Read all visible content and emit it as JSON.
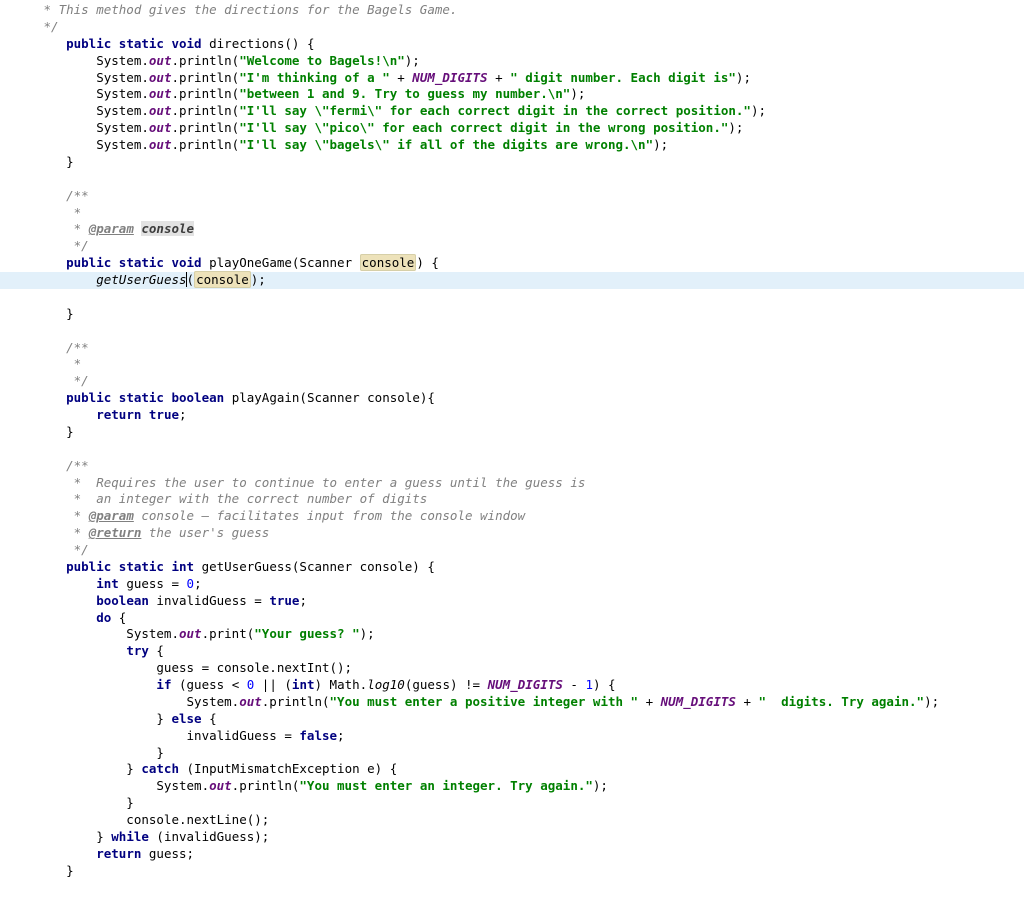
{
  "method_directions": {
    "doc_line1": " * This method gives the directions for the Bagels Game.",
    "doc_close": " */",
    "sig_kw1": "public",
    "sig_kw2": "static",
    "sig_kw3": "void",
    "sig_name": "directions",
    "l1_pre": "        System.",
    "l1_out": "out",
    "l1_mid": ".println(",
    "l1_str": "\"Welcome to Bagels!\\n\"",
    "l1_end": ");",
    "l2_pre": "        System.",
    "l2_out": "out",
    "l2_mid": ".println(",
    "l2_str1": "\"I'm thinking of a \"",
    "l2_plus1": " + ",
    "l2_const": "NUM_DIGITS",
    "l2_plus2": " + ",
    "l2_str2": "\" digit number. Each digit is\"",
    "l2_end": ");",
    "l3_pre": "        System.",
    "l3_out": "out",
    "l3_mid": ".println(",
    "l3_str": "\"between 1 and 9. Try to guess my number.\\n\"",
    "l3_end": ");",
    "l4_pre": "        System.",
    "l4_out": "out",
    "l4_mid": ".println(",
    "l4_str": "\"I'll say \\\"fermi\\\" for each correct digit in the correct position.\"",
    "l4_end": ");",
    "l5_pre": "        System.",
    "l5_out": "out",
    "l5_mid": ".println(",
    "l5_str": "\"I'll say \\\"pico\\\" for each correct digit in the wrong position.\"",
    "l5_end": ");",
    "l6_pre": "        System.",
    "l6_out": "out",
    "l6_mid": ".println(",
    "l6_str": "\"I'll say \\\"bagels\\\" if all of the digits are wrong.\\n\"",
    "l6_end": ");",
    "close": "    }"
  },
  "method_playone": {
    "doc_open": "    /**",
    "doc_star": "     *",
    "doc_param_tag": "@param",
    "doc_param_name": "console",
    "doc_close": "     */",
    "sig_kw1": "public",
    "sig_kw2": "static",
    "sig_kw3": "void",
    "sig_name": "playOneGame",
    "sig_ptype": "Scanner",
    "sig_pname": "console",
    "body_call": "getUserGuess",
    "body_arg": "console",
    "close": "    }"
  },
  "method_playagain": {
    "doc_open": "    /**",
    "doc_star": "     *",
    "doc_close": "     */",
    "sig_kw1": "public",
    "sig_kw2": "static",
    "sig_kw3": "boolean",
    "sig_name": "playAgain",
    "sig_ptype": "Scanner",
    "sig_pname": "console",
    "ret_kw": "return",
    "ret_val": "true",
    "close": "    }"
  },
  "method_getguess": {
    "doc_open": "    /**",
    "doc_l1": "     *  Requires the user to continue to enter a guess until the guess is",
    "doc_l2": "     *  an integer with the correct number of digits",
    "doc_param_tag": "@param",
    "doc_param_rest": " console – facilitates input from the console window",
    "doc_ret_tag": "@return",
    "doc_ret_rest": " the user's guess",
    "doc_close": "     */",
    "sig_kw1": "public",
    "sig_kw2": "static",
    "sig_kw3": "int",
    "sig_name": "getUserGuess",
    "sig_ptype": "Scanner",
    "sig_pname": "console",
    "b1_kw": "int",
    "b1_var": " guess = ",
    "b1_num": "0",
    "b1_end": ";",
    "b2_kw": "boolean",
    "b2_var": " invalidGuess = ",
    "b2_val": "true",
    "b2_end": ";",
    "do_kw": "do",
    "p_pre": "            System.",
    "p_out": "out",
    "p_mid": ".print(",
    "p_str": "\"Your guess? \"",
    "p_end": ");",
    "try_kw": "try",
    "ni": "                guess = console.nextInt();",
    "if_kw": "if",
    "if_cond_pre": " (guess < ",
    "if_num0": "0",
    "if_mid": " || (",
    "if_cast": "int",
    "if_mid2": ") Math.",
    "if_log": "log10",
    "if_mid3": "(guess) != ",
    "if_const": "NUM_DIGITS",
    "if_mid4": " - ",
    "if_num1": "1",
    "if_end": ") {",
    "err_pre": "                    System.",
    "err_out": "out",
    "err_mid": ".println(",
    "err_str1": "\"You must enter a positive integer with \"",
    "err_plus1": " + ",
    "err_const": "NUM_DIGITS",
    "err_plus2": " + ",
    "err_str2": "\"  digits. Try again.\"",
    "err_end": ");",
    "else_kw": "else",
    "inv": "                    invalidGuess = ",
    "inv_val": "false",
    "inv_end": ";",
    "cb1": "                }",
    "catch_kw": "catch",
    "catch_type": "InputMismatchException",
    "catch_var": "e",
    "err2_pre": "                System.",
    "err2_out": "out",
    "err2_mid": ".println(",
    "err2_str": "\"You must enter an integer. Try again.\"",
    "err2_end": ");",
    "cb2": "            }",
    "nl": "            console.nextLine();",
    "while_kw": "while",
    "while_rest": " (invalidGuess);",
    "ret_kw": "return",
    "ret_rest": " guess;",
    "close": "    }"
  }
}
